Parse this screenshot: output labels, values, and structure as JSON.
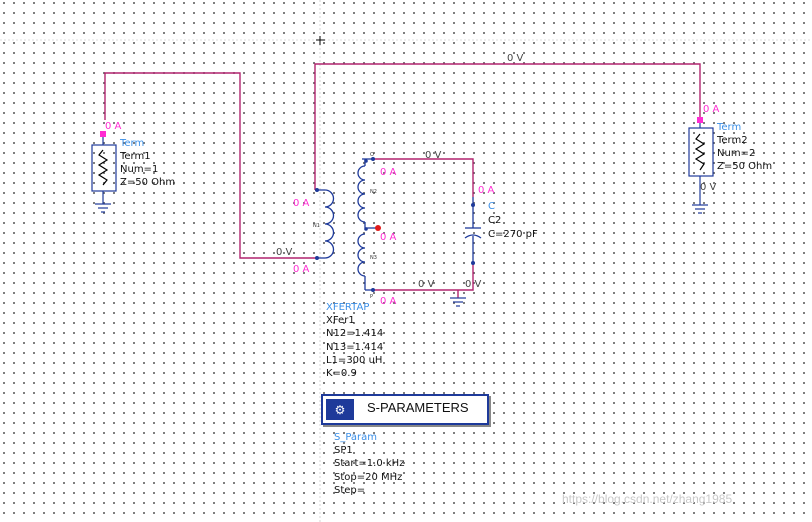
{
  "term1": {
    "current": "0 A",
    "type": "Term",
    "name": "Term1",
    "num": "Num=1",
    "z": "Z=50 Ohm"
  },
  "term2": {
    "current": "0 A",
    "type": "Term",
    "name": "Term2",
    "num": "Num=2",
    "z": "Z=50 Ohm",
    "voltage": "0 V"
  },
  "xfer": {
    "type": "XFERTAP",
    "name": "XFer1",
    "n12": "N12=1.414",
    "n13": "N13=1.414",
    "l1": "L1=300 uH",
    "k": "K=0.9",
    "pin_n1": "N1",
    "pin_n2": "N2",
    "pin_n3": "N3",
    "pin_p": "P",
    "pin_o": "O"
  },
  "cap": {
    "type": "C",
    "name": "C2",
    "value": "C=270 pF",
    "current": "0 A",
    "voltage": "0 V"
  },
  "node_labels": {
    "top_wire_voltage": "0 V",
    "left_bottom_voltage": "0 V",
    "secondary_top_voltage": "0 V",
    "secondary_bottom_voltage": "0 V",
    "prim_top_current": "0 A",
    "prim_bottom_current": "0 A",
    "sec_top_current": "0 A",
    "tap_current": "0 A",
    "sec_bottom_current": "0 A"
  },
  "sparam": {
    "title": "S-PARAMETERS",
    "type": "S_Param",
    "name": "SP1",
    "start": "Start=1.0 kHz",
    "stop": "Stop=20 MHz",
    "step": "Step="
  },
  "watermark": "https://blog.csdn.net/zhang1985"
}
